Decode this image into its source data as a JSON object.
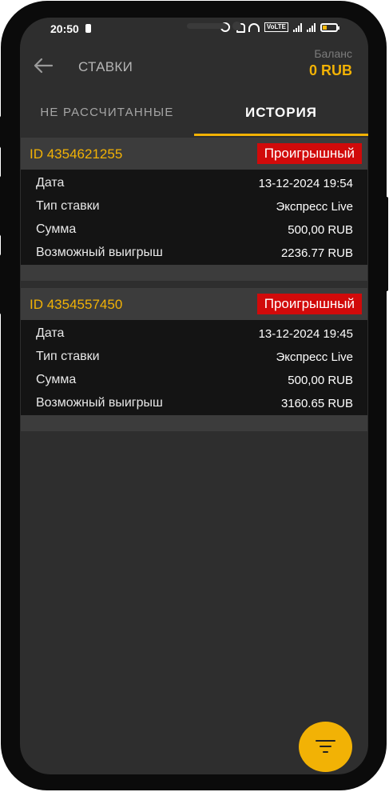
{
  "status_bar": {
    "time": "20:50",
    "volte": "VoLTE"
  },
  "header": {
    "title": "СТАВКИ",
    "balance_label": "Баланс",
    "balance_value": "0 RUB"
  },
  "tabs": [
    {
      "label": "НЕ РАССЧИТАННЫЕ",
      "active": false
    },
    {
      "label": "ИСТОРИЯ",
      "active": true
    }
  ],
  "bets": [
    {
      "id": "ID 4354621255",
      "status": "Проигрышный",
      "rows": [
        {
          "label": "Дата",
          "value": "13-12-2024 19:54"
        },
        {
          "label": "Тип ставки",
          "value": "Экспресс Live"
        },
        {
          "label": "Сумма",
          "value": "500,00 RUB"
        },
        {
          "label": "Возможный выигрыш",
          "value": "2236.77 RUB"
        }
      ]
    },
    {
      "id": "ID 4354557450",
      "status": "Проигрышный",
      "rows": [
        {
          "label": "Дата",
          "value": "13-12-2024 19:45"
        },
        {
          "label": "Тип ставки",
          "value": "Экспресс Live"
        },
        {
          "label": "Сумма",
          "value": "500,00 RUB"
        },
        {
          "label": "Возможный выигрыш",
          "value": "3160.65 RUB"
        }
      ]
    }
  ],
  "colors": {
    "accent": "#f2b205",
    "loss_status": "#d10a0a",
    "background": "#2e2e2e"
  },
  "icons": {
    "back": "arrow-left-icon",
    "filter": "filter-icon"
  }
}
